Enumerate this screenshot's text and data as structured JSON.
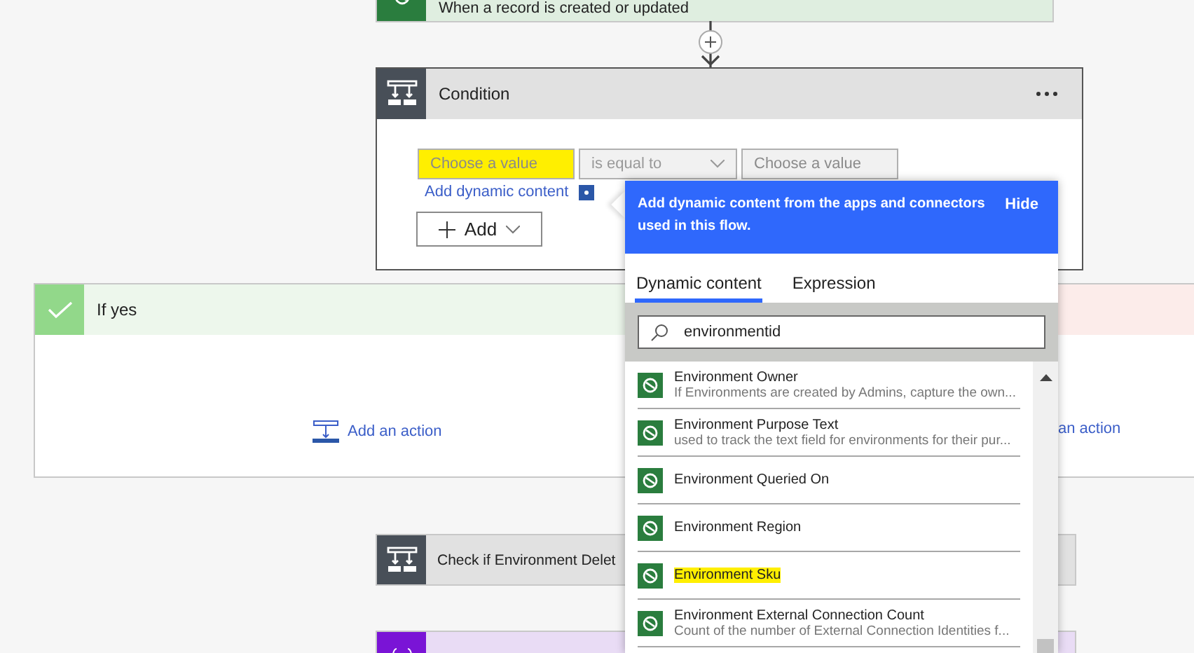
{
  "trigger": {
    "title": "When a record is created or updated"
  },
  "condition": {
    "title": "Condition",
    "left_value": {
      "placeholder": "Choose a value",
      "highlighted": true
    },
    "operator": {
      "value": "is equal to"
    },
    "right_value": {
      "placeholder": "Choose a value"
    },
    "dynamic_link": "Add dynamic content",
    "add_button": "Add"
  },
  "branches": [
    {
      "kind": "yes",
      "title": "If yes",
      "action_link": "Add an action"
    },
    {
      "kind": "no",
      "action_link": "an action"
    }
  ],
  "next_steps": [
    {
      "kind": "condition",
      "title": "Check if Environment Delet"
    },
    {
      "kind": "variable"
    }
  ],
  "dynamic_panel": {
    "message": "Add dynamic content from the apps and connectors used in this flow.",
    "hide": "Hide",
    "tabs": [
      {
        "label": "Dynamic content",
        "selected": true
      },
      {
        "label": "Expression",
        "selected": false
      }
    ],
    "search": {
      "value": "environmentid"
    },
    "items": [
      {
        "name": "Environment Owner",
        "description": "If Environments are created by Admins, capture the own...",
        "highlighted": false
      },
      {
        "name": "Environment Purpose Text",
        "description": "used to track the text field for environments for their pur...",
        "highlighted": false
      },
      {
        "name": "Environment Queried On",
        "highlighted": false
      },
      {
        "name": "Environment Region",
        "highlighted": false
      },
      {
        "name": "Environment Sku",
        "highlighted": true
      },
      {
        "name": "Environment External Connection Count",
        "description": "Count of the number of External Connection Identities f...",
        "highlighted": false
      }
    ]
  }
}
